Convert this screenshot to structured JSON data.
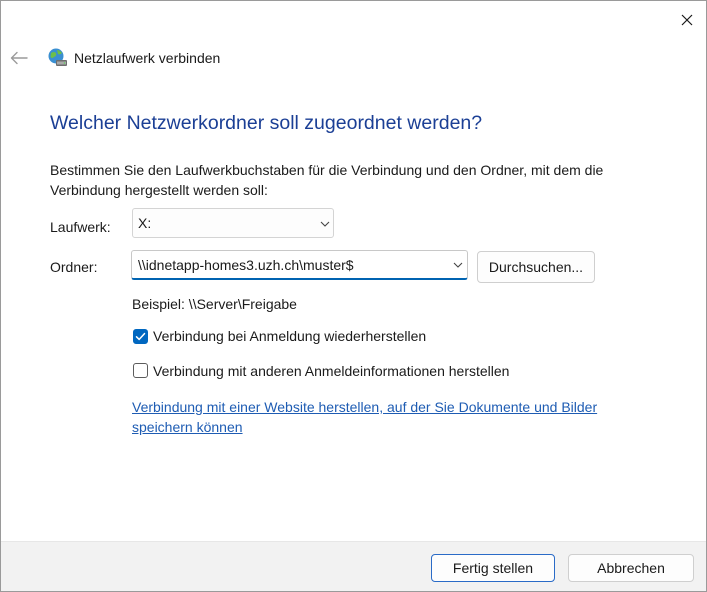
{
  "window": {
    "title": "Netzlaufwerk verbinden",
    "close_icon": "close-icon",
    "back_icon": "back-arrow-icon"
  },
  "main": {
    "heading": "Welcher Netzwerkordner soll zugeordnet werden?",
    "instructions": "Bestimmen Sie den Laufwerkbuchstaben für die Verbindung und den Ordner, mit dem die Verbindung hergestellt werden soll:",
    "drive_label": "Laufwerk:",
    "drive_value": "X:",
    "folder_label": "Ordner:",
    "folder_value": "\\\\idnetapp-homes3.uzh.ch\\muster$",
    "browse_label": "Durchsuchen...",
    "example_text": "Beispiel: \\\\Server\\Freigabe",
    "reconnect_label": "Verbindung bei Anmeldung wiederherstellen",
    "reconnect_checked": true,
    "other_credentials_label": "Verbindung mit anderen Anmeldeinformationen herstellen",
    "other_credentials_checked": false,
    "website_link": "Verbindung mit einer Website herstellen, auf der Sie Dokumente und Bilder speichern können"
  },
  "footer": {
    "finish_label": "Fertig stellen",
    "cancel_label": "Abbrechen"
  },
  "colors": {
    "heading": "#1b3f95",
    "accent": "#0067c0",
    "link": "#1e5cb3",
    "footer_bg": "#f2f2f2"
  }
}
